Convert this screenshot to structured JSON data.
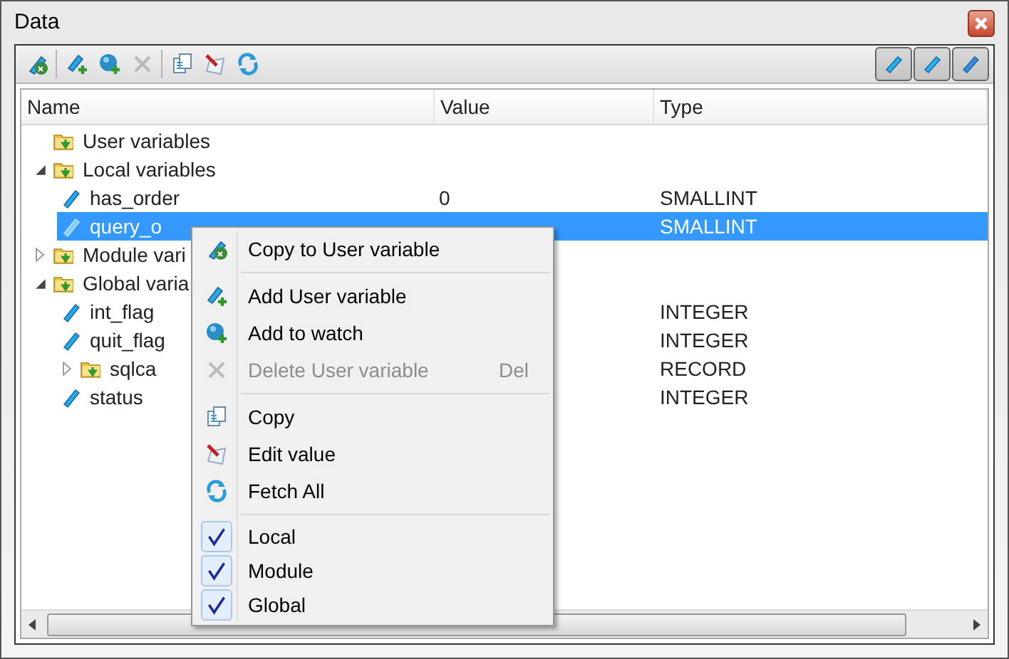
{
  "window": {
    "title": "Data"
  },
  "toolbar": {
    "buttons": [
      {
        "disabled": false
      },
      {
        "disabled": false
      },
      {
        "disabled": false
      },
      {
        "disabled": true
      },
      {
        "disabled": false
      },
      {
        "disabled": false
      },
      {
        "disabled": false
      }
    ],
    "toggles": [
      {
        "checked": true
      },
      {
        "checked": true
      },
      {
        "checked": true
      }
    ]
  },
  "table": {
    "columns": [
      "Name",
      "Value",
      "Type"
    ],
    "rows": [
      {
        "kind": "folder",
        "name": "User variables",
        "selected": false
      },
      {
        "kind": "folder",
        "name": "Local variables",
        "expanded": true,
        "selected": false,
        "children": [
          {
            "kind": "variable",
            "name": "has_order",
            "value": "0",
            "type": "SMALLINT",
            "selected": false
          },
          {
            "kind": "variable",
            "name": "query_o",
            "type": "SMALLINT",
            "selected": true
          }
        ]
      },
      {
        "kind": "folder",
        "name": "Module vari",
        "expanded": false,
        "selected": false
      },
      {
        "kind": "folder",
        "name": "Global varia",
        "expanded": true,
        "selected": false,
        "children": [
          {
            "kind": "variable",
            "name": "int_flag",
            "type": "INTEGER",
            "selected": false
          },
          {
            "kind": "variable",
            "name": "quit_flag",
            "type": "INTEGER",
            "selected": false
          },
          {
            "kind": "folder",
            "name": "sqlca",
            "type": "RECORD",
            "expanded": false,
            "selected": false
          },
          {
            "kind": "variable",
            "name": "status",
            "type": "INTEGER",
            "selected": false
          }
        ]
      }
    ]
  },
  "context_menu": {
    "items": [
      {
        "kind": "item",
        "label": "Copy to User variable",
        "disabled": false
      },
      {
        "kind": "separator"
      },
      {
        "kind": "item",
        "label": "Add User variable",
        "disabled": false
      },
      {
        "kind": "item",
        "label": "Add to watch",
        "disabled": false
      },
      {
        "kind": "item",
        "label": "Delete User variable",
        "shortcut": "Del",
        "disabled": true
      },
      {
        "kind": "separator"
      },
      {
        "kind": "item",
        "label": "Copy",
        "disabled": false
      },
      {
        "kind": "item",
        "label": "Edit value",
        "disabled": false
      },
      {
        "kind": "item",
        "label": "Fetch All",
        "disabled": false
      },
      {
        "kind": "separator"
      },
      {
        "kind": "check",
        "label": "Local",
        "checked": true
      },
      {
        "kind": "check",
        "label": "Module",
        "checked": true
      },
      {
        "kind": "check",
        "label": "Global",
        "checked": true
      }
    ]
  }
}
